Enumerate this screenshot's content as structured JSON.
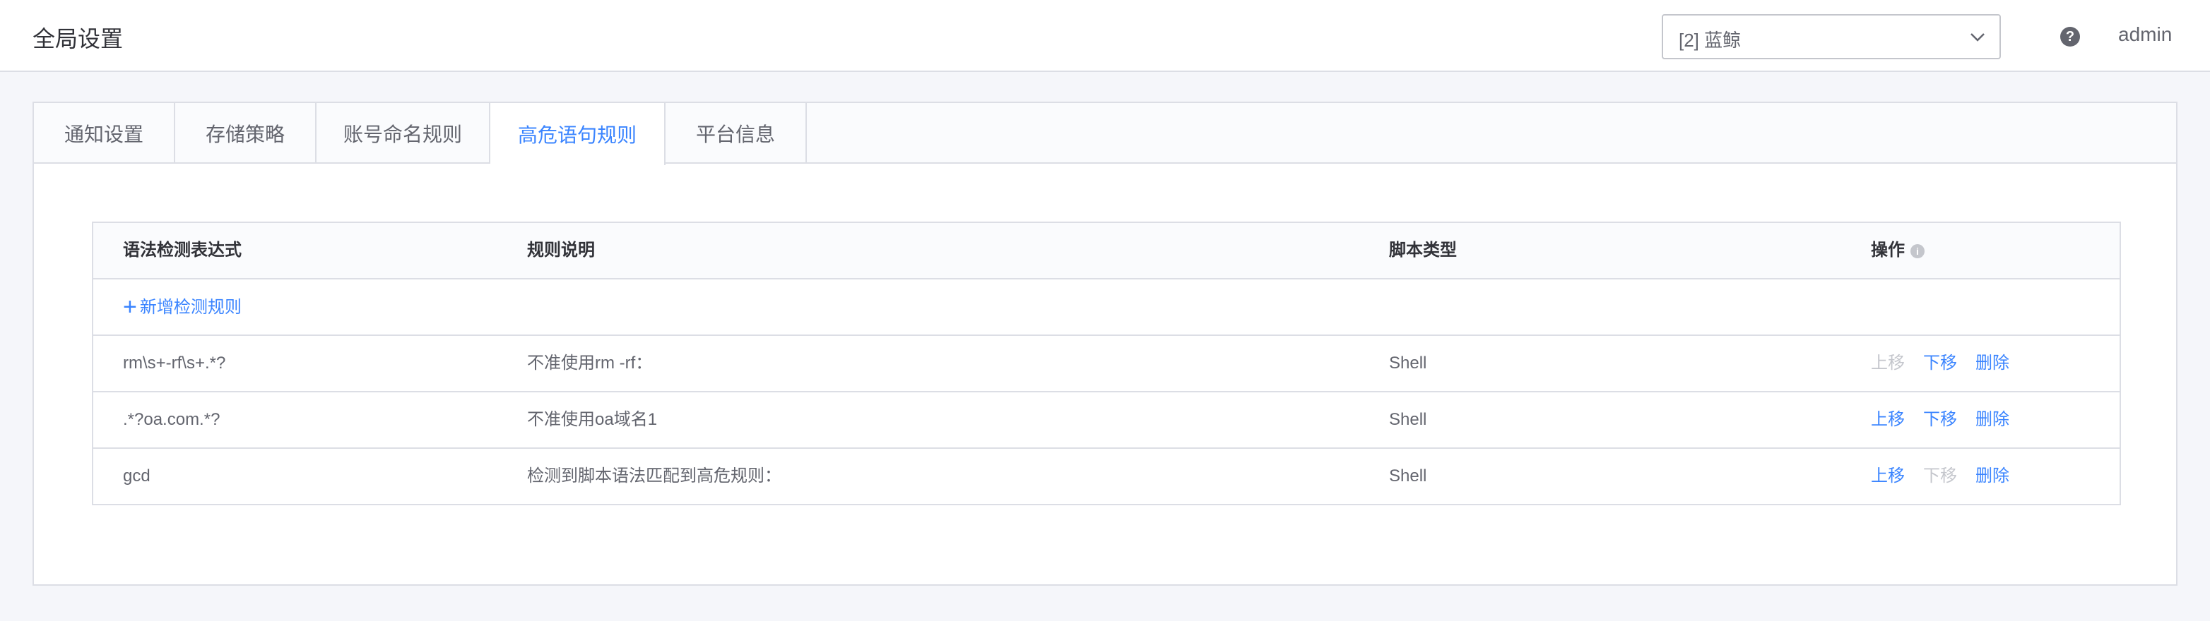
{
  "header": {
    "title": "全局设置",
    "business_select": "[2] 蓝鲸",
    "help": "?",
    "user": "admin"
  },
  "tabs": [
    {
      "label": "通知设置",
      "active": false
    },
    {
      "label": "存储策略",
      "active": false
    },
    {
      "label": "账号命名规则",
      "active": false
    },
    {
      "label": "高危语句规则",
      "active": true
    },
    {
      "label": "平台信息",
      "active": false
    }
  ],
  "table": {
    "columns": [
      "语法检测表达式",
      "规则说明",
      "脚本类型",
      "操作"
    ],
    "add_label": "新增检测规则",
    "rows": [
      {
        "expression": "rm\\s+-rf\\s+.*?",
        "description": "不准使用rm -rf：",
        "script_type": "Shell",
        "actions": {
          "up": "上移",
          "down": "下移",
          "delete": "删除",
          "up_disabled": true,
          "down_disabled": false
        }
      },
      {
        "expression": ".*?oa.com.*?",
        "description": "不准使用oa域名1",
        "script_type": "Shell",
        "actions": {
          "up": "上移",
          "down": "下移",
          "delete": "删除",
          "up_disabled": false,
          "down_disabled": false
        }
      },
      {
        "expression": "gcd",
        "description": "检测到脚本语法匹配到高危规则：",
        "script_type": "Shell",
        "actions": {
          "up": "上移",
          "down": "下移",
          "delete": "删除",
          "up_disabled": false,
          "down_disabled": true
        }
      }
    ]
  },
  "colors": {
    "accent": "#3a84ff",
    "disabled": "#c4c6cc",
    "border": "#dcdee5",
    "background": "#f5f6fa"
  },
  "icons": {
    "select_arrow": "chevron-down-icon",
    "help": "question-circle-icon",
    "column_info": "info-icon",
    "add": "plus-icon"
  }
}
